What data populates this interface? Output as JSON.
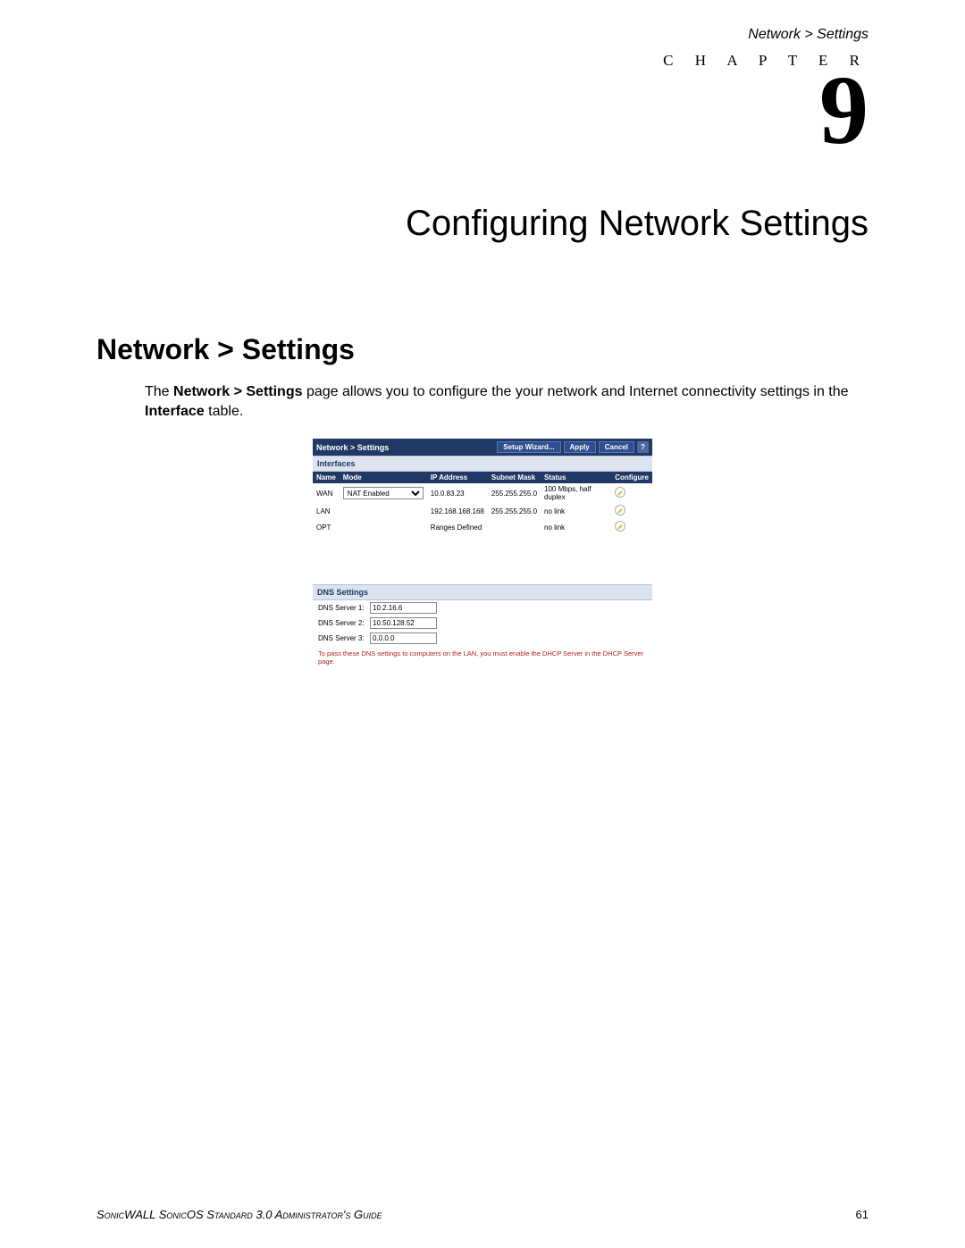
{
  "header": {
    "breadcrumb": "Network > Settings"
  },
  "chapter": {
    "label": "C H A P T E R",
    "number": "9",
    "title": "Configuring Network Settings"
  },
  "section": {
    "title": "Network > Settings"
  },
  "body": {
    "prefix": "The ",
    "bold1": "Network > Settings",
    "mid": " page allows you to configure the your network and Internet connectivity settings in the ",
    "bold2": "Interface",
    "suffix": " table."
  },
  "ui": {
    "titlebar": "Network > Settings",
    "buttons": {
      "wizard": "Setup Wizard...",
      "apply": "Apply",
      "cancel": "Cancel",
      "help": "?"
    },
    "sections": {
      "interfaces": "Interfaces",
      "dns": "DNS Settings"
    },
    "columns": {
      "name": "Name",
      "mode": "Mode",
      "ip": "IP Address",
      "mask": "Subnet Mask",
      "status": "Status",
      "configure": "Configure"
    },
    "rows": [
      {
        "name": "WAN",
        "mode": "NAT Enabled",
        "ip": "10.0.83.23",
        "mask": "255.255.255.0",
        "status": "100 Mbps, half duplex"
      },
      {
        "name": "LAN",
        "mode": "",
        "ip": "192.168.168.168",
        "mask": "255.255.255.0",
        "status": "no link"
      },
      {
        "name": "OPT",
        "mode": "",
        "ip": "Ranges Defined",
        "mask": "",
        "status": "no link"
      }
    ],
    "dns": [
      {
        "label": "DNS Server 1:",
        "value": "10.2.16.6"
      },
      {
        "label": "DNS Server 2:",
        "value": "10.50.128.52"
      },
      {
        "label": "DNS Server 3:",
        "value": "0.0.0.0"
      }
    ],
    "dns_note": "To pass these DNS settings to computers on the LAN, you must enable the DHCP Server in the DHCP Server page."
  },
  "footer": {
    "left": "SonicWALL SonicOS Standard 3.0 Administrator's Guide",
    "page": "61"
  }
}
